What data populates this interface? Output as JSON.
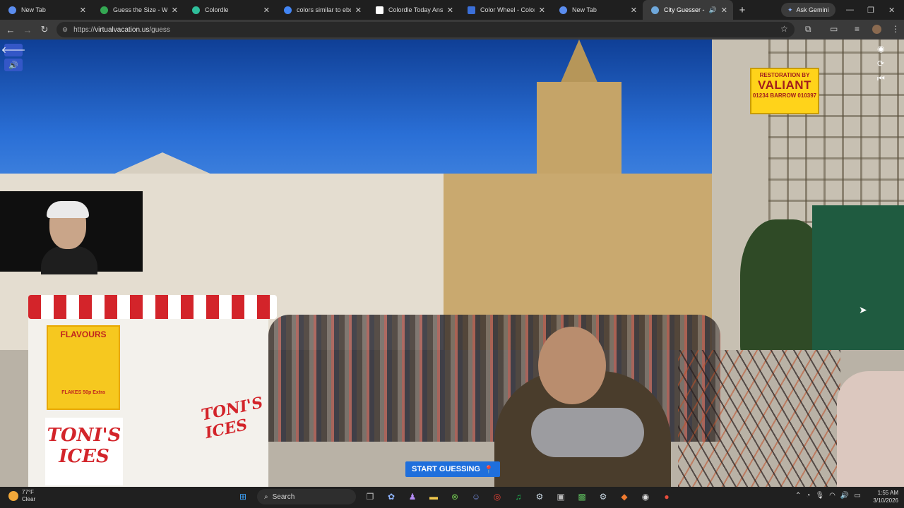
{
  "tabs": [
    {
      "title": "New Tab",
      "favicon_color": "#5b8def"
    },
    {
      "title": "Guess the Size - Worldl",
      "favicon_color": "#34a853"
    },
    {
      "title": "Colordle",
      "favicon_color": "#2fbf9b"
    },
    {
      "title": "colors similar to ebony",
      "favicon_color": "#4285f4"
    },
    {
      "title": "Colordle Today Answe",
      "favicon_color": "#ffffff"
    },
    {
      "title": "Color Wheel - Color Ca",
      "favicon_color": "#3b6fd8"
    },
    {
      "title": "New Tab",
      "favicon_color": "#5b8def"
    },
    {
      "title": "City Guesser - Can",
      "favicon_color": "#6fa8dc",
      "active": true
    }
  ],
  "new_tab_label": "+",
  "gemini_label": "Ask Gemini",
  "address": {
    "scheme": "https://",
    "host": "virtualvacation.us",
    "path": "/guess"
  },
  "sign": {
    "line1": "RESTORATION BY",
    "line2": "VALIANT",
    "line3": "01234 BARROW 010397"
  },
  "vendor": {
    "panel_title": "FLAVOURS",
    "logo": "TONI'S ICES",
    "logo_side": "TONI'S ICES",
    "prices": "FLAKES 50p Extra"
  },
  "start_button": {
    "label": "START GUESSING",
    "icon": "map-pin-icon"
  },
  "taskbar": {
    "weather_temp": "77°F",
    "weather_desc": "Clear",
    "search_label": "Search",
    "time": "1:55 AM",
    "date": "3/10/2026"
  },
  "colors": {
    "accent": "#1f6fdc",
    "tab_active": "#3a3a3a",
    "chrome_bg": "#1f1f1f"
  }
}
